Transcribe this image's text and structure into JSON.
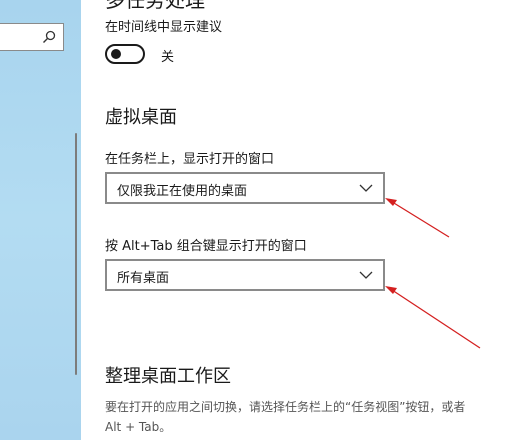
{
  "sidebar": {
    "search_icon": "search-icon"
  },
  "top_title_partial": "多任务处理",
  "timeline": {
    "label": "在时间线中显示建议",
    "toggle_state": "关",
    "toggle_on": false
  },
  "virtual_desktops": {
    "heading": "虚拟桌面",
    "taskbar": {
      "label": "在任务栏上，显示打开的窗口",
      "selected": "仅限我正在使用的桌面"
    },
    "alttab": {
      "label": "按 Alt+Tab 组合键显示打开的窗口",
      "selected": "所有桌面"
    }
  },
  "snap": {
    "heading": "整理桌面工作区",
    "desc_line1": "要在打开的应用之间切换，请选择任务栏上的“任务视图”按钮，或者",
    "desc_line2": "Alt + Tab。"
  },
  "colors": {
    "sidebar_bg": "#a8d4ee",
    "annotation_arrow": "#d42020",
    "text": "#1a1a1a"
  }
}
